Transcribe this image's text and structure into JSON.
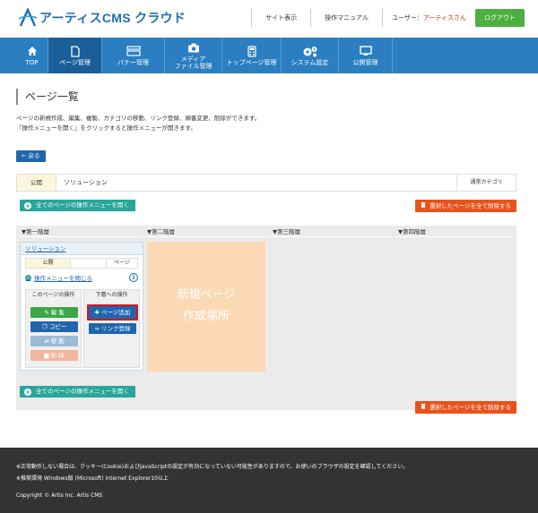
{
  "header": {
    "logo_text": "アーティスCMS クラウド",
    "links": [
      "サイト表示",
      "操作マニュアル"
    ],
    "user_label": "ユーザー：",
    "user_name": "アーティスさん",
    "logout_label": "ログアウト"
  },
  "nav": {
    "items": [
      {
        "label": "TOP",
        "icon": "home-icon"
      },
      {
        "label": "ページ管理",
        "icon": "document-icon"
      },
      {
        "label": "バナー管理",
        "icon": "banner-icon"
      },
      {
        "label": "メディア\nファイル管理",
        "line1": "メディア",
        "line2": "ファイル管理",
        "icon": "camera-icon"
      },
      {
        "label": "トップページ管理",
        "icon": "calculator-icon"
      },
      {
        "label": "システム設定",
        "icon": "gears-icon"
      },
      {
        "label": "公開管理",
        "icon": "monitor-icon"
      }
    ],
    "active_index": 1
  },
  "page": {
    "title": "ページ一覧",
    "description_1": "ページの新規作成、編集、複製、カテゴリの移動、リンク登録、順番変更、削除ができます。",
    "description_2": "『操作メニューを開く』をクリックすると操作メニューが開きます。",
    "back_label": "← 戻る"
  },
  "filter": {
    "status": "公開",
    "name": "ソリューション",
    "category": "通常カテゴリ"
  },
  "actions": {
    "open_all_menu": "全てのページの操作メニューを開く",
    "delete_selected": "選択したページを全て削除する"
  },
  "tree": {
    "tiers": [
      "▼第一階層",
      "▼第二階層",
      "▼第三階層",
      "▼第四階層"
    ],
    "card": {
      "title": "ソリューション",
      "status": "公開",
      "type": "ページ",
      "close_menu": "操作メニューを閉じる",
      "this_page_ops": "このページの操作",
      "child_ops": "下層への操作",
      "edit": "編 集",
      "copy": "コピー",
      "move": "移 動",
      "delete": "削 除",
      "add_page": "ページ追加",
      "link_register": "リンク登録"
    },
    "new_page_line1": "新規ページ",
    "new_page_line2": "作成場所"
  },
  "footer": {
    "notice": "※正常動作しない場合は、クッキー(Cookie)およびJavaScriptの設定が有効になっていない可能性がありますので、お使いのブラウザの設定を確認してください。",
    "env": "※推奨環境 Windows版 (Microsoft) Internet Explorer10以上",
    "copyright": "Copyright © Artis Inc. Artis CMS"
  },
  "colors": {
    "nav_bg": "#2a7ec1",
    "nav_active": "#1a5f99",
    "accent_green": "#4caf3f",
    "teal": "#2aa59a",
    "danger": "#e8531c",
    "new_page_bg": "#fcd9b5",
    "highlight_border": "#d9141b"
  }
}
